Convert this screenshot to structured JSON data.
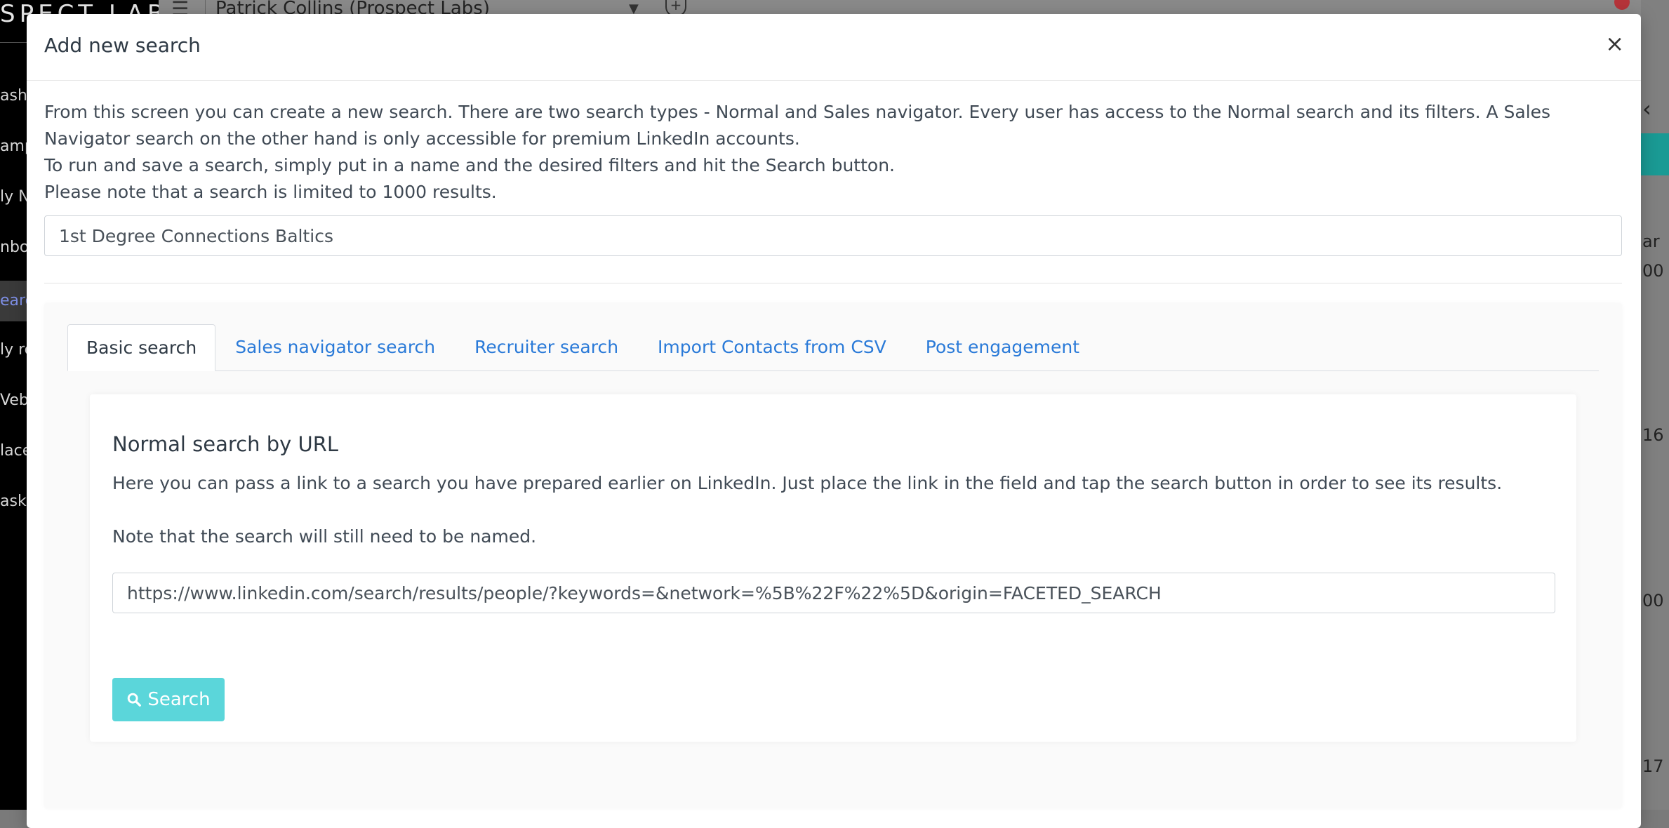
{
  "background": {
    "brand": "SPECT LABS",
    "account_selector": "Patrick Collins (Prospect Labs)",
    "nav_items": [
      {
        "label": "ash"
      },
      {
        "label": "amp"
      },
      {
        "label": "ly N"
      },
      {
        "label": "nbox"
      },
      {
        "label": "earc"
      },
      {
        "label": "ly re"
      },
      {
        "label": "Veb"
      },
      {
        "label": "lace"
      },
      {
        "label": "asks"
      }
    ],
    "right_fragments": [
      "ar",
      "00",
      "16",
      "00",
      "17"
    ]
  },
  "modal": {
    "title": "Add new search",
    "close_label": "×",
    "intro_lines": [
      "From this screen you can create a new search. There are two search types - Normal and Sales navigator. Every user has access to the Normal search and its filters. A Sales",
      "Navigator search on the other hand is only accessible for premium LinkedIn accounts.",
      "To run and save a search, simply put in a name and the desired filters and hit the Search button.",
      "Please note that a search is limited to 1000 results."
    ],
    "search_name_value": "1st Degree Connections Baltics",
    "tabs": [
      {
        "label": "Basic search",
        "active": true
      },
      {
        "label": "Sales navigator search",
        "active": false
      },
      {
        "label": "Recruiter search",
        "active": false
      },
      {
        "label": "Import Contacts from CSV",
        "active": false
      },
      {
        "label": "Post engagement",
        "active": false
      }
    ],
    "card": {
      "title": "Normal search by URL",
      "description": "Here you can pass a link to a search you have prepared earlier on LinkedIn. Just place the link in the field and tap the search button in order to see its results.",
      "note": "Note that the search will still need to be named.",
      "url_value": "https://www.linkedin.com/search/results/people/?keywords=&network=%5B%22F%22%5D&origin=FACETED_SEARCH",
      "search_button_label": "Search",
      "search_button_icon": "search-icon"
    }
  },
  "colors": {
    "accent_link": "#2a7ad8",
    "search_button": "#5bd6da",
    "text": "#404a55"
  }
}
